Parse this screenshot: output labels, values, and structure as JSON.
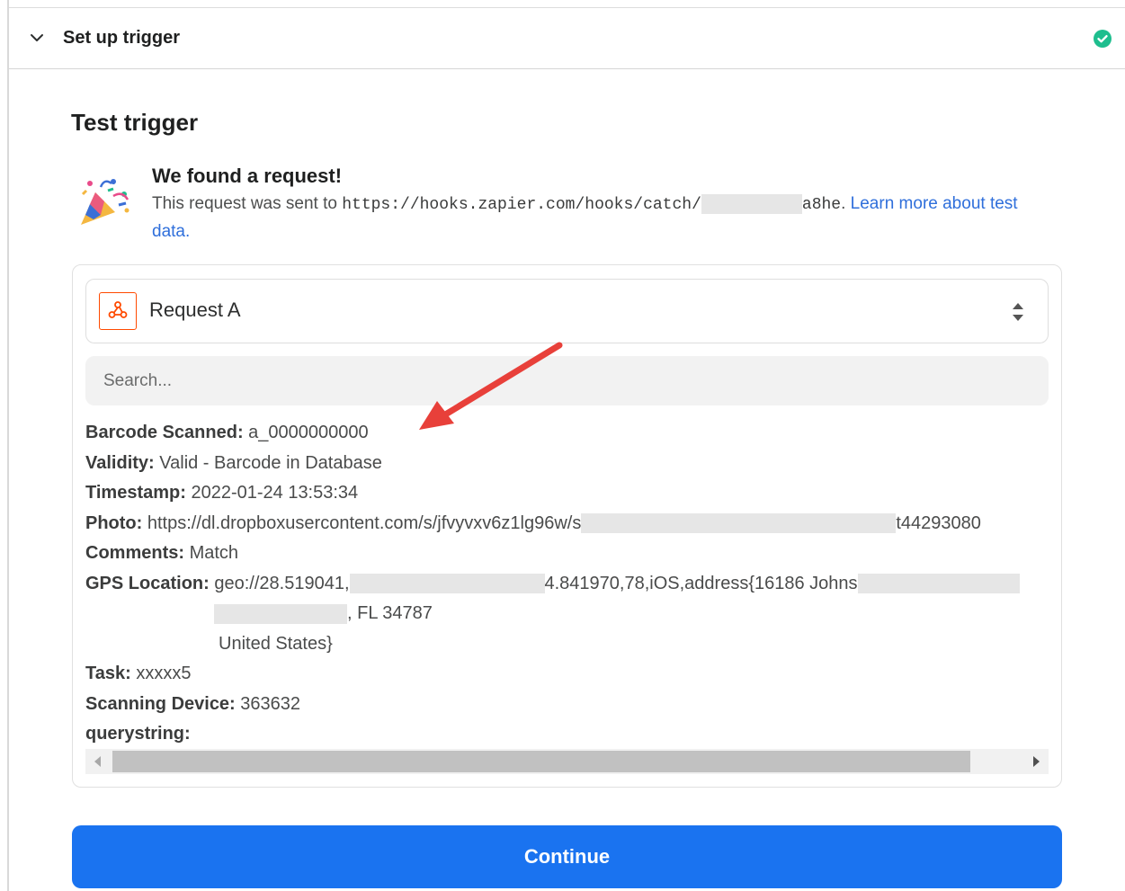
{
  "header": {
    "title": "Set up trigger",
    "status_color": "#1ebe8e"
  },
  "test": {
    "title": "Test trigger",
    "found_title": "We found a request!",
    "desc_prefix": "This request was sent to ",
    "url_start": "https://hooks.zapier.com/hooks/catch/",
    "url_end": "a8he",
    "after_url": ". ",
    "learn_more": "Learn more about test data",
    "period": "."
  },
  "panel": {
    "selector_label": "Request A",
    "search_placeholder": "Search..."
  },
  "fields": [
    {
      "key": "Barcode Scanned:",
      "value": "a_0000000000"
    },
    {
      "key": "Validity:",
      "value": "Valid - Barcode in Database"
    },
    {
      "key": "Timestamp:",
      "value": "2022-01-24 13:53:34"
    },
    {
      "key": "Photo:",
      "value": "https://dl.dropboxusercontent.com/s/jfvyvxv6z1lg96w/s",
      "value_end": "t44293080"
    },
    {
      "key": "Comments:",
      "value": "Match"
    },
    {
      "key": "GPS Location:",
      "value": "geo://28.519041,",
      "value_mid": "4.841970,78,iOS,address{16186 Johns",
      "line2_end": ", FL 34787",
      "line3": "United States}"
    },
    {
      "key": "Task:",
      "value": "xxxxx5"
    },
    {
      "key": "Scanning Device:",
      "value": "363632"
    },
    {
      "key": "querystring:",
      "value": ""
    }
  ],
  "continue_label": "Continue",
  "colors": {
    "accent": "#1a73f0",
    "link": "#2f6fdb",
    "app_icon": "#ff4a00",
    "annotation_arrow": "#e8403a"
  }
}
